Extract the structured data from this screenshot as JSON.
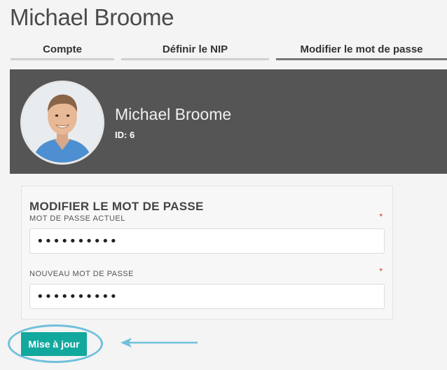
{
  "page": {
    "title": "Michael Broome"
  },
  "tabs": [
    {
      "label": "Compte",
      "active": false
    },
    {
      "label": "Définir le NIP",
      "active": false
    },
    {
      "label": "Modifier le mot de passe",
      "active": true
    }
  ],
  "profile": {
    "name": "Michael Broome",
    "id_text": "ID: 6"
  },
  "form": {
    "title": "MODIFIER LE MOT DE PASSE",
    "required_mark": "*",
    "current_password": {
      "label": "MOT DE PASSE ACTUEL",
      "value": "••••••••••"
    },
    "new_password": {
      "label": "NOUVEAU MOT DE PASSE",
      "value": "••••••••••"
    },
    "submit_label": "Mise à jour"
  },
  "colors": {
    "banner": "#555555",
    "accent": "#13a89e",
    "highlight": "#6fc0dc",
    "required": "#d0342c"
  },
  "icons": {
    "arrow": "left-arrow-icon"
  }
}
